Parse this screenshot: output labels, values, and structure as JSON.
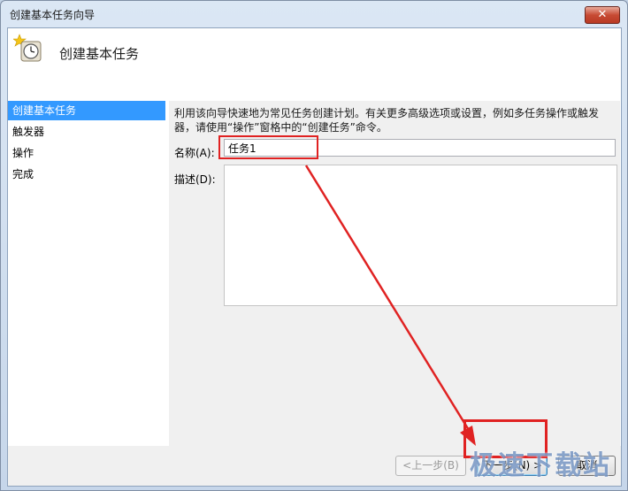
{
  "window": {
    "title": "创建基本任务向导",
    "close_glyph": "✕"
  },
  "header": {
    "title": "创建基本任务",
    "icon": "clock-icon"
  },
  "nav": {
    "items": [
      {
        "label": "创建基本任务",
        "active": true
      },
      {
        "label": "触发器",
        "active": false
      },
      {
        "label": "操作",
        "active": false
      },
      {
        "label": "完成",
        "active": false
      }
    ]
  },
  "content": {
    "intro": "利用该向导快速地为常见任务创建计划。有关更多高级选项或设置，例如多任务操作或触发器，请使用“操作”窗格中的“创建任务”命令。",
    "name_label": "名称(A):",
    "name_value": "任务1",
    "desc_label": "描述(D):",
    "desc_value": ""
  },
  "footer": {
    "back_label": "<上一步(B)",
    "next_label": "下一步(N) >",
    "cancel_label": "取消"
  },
  "watermark": "极速下载站",
  "colors": {
    "highlight": "#e02222",
    "nav_active": "#3399ff"
  }
}
